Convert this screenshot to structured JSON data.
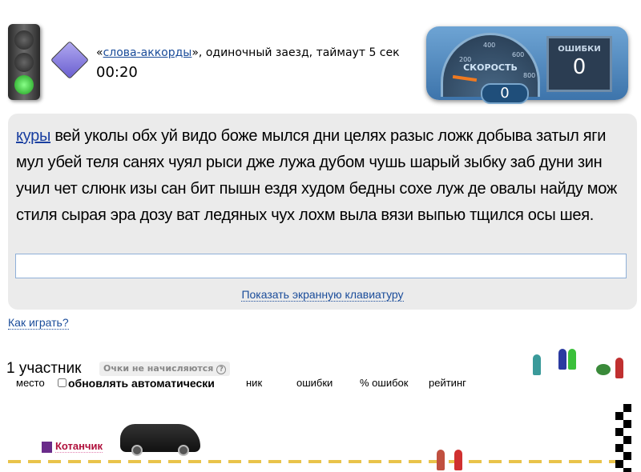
{
  "game": {
    "quote_open": "«",
    "mode_link": "слова-аккорды",
    "quote_rest": "», одиночный заезд, таймаут 5 сек",
    "timer": "00:20"
  },
  "dashboard": {
    "speed_label": "СКОРОСТЬ",
    "speed": "0",
    "ticks": [
      "200",
      "400",
      "600",
      "800"
    ],
    "errors_label": "ОШИБКИ",
    "errors": "0"
  },
  "text": {
    "current_word": "куры",
    "rest": " вей уколы обх уй видо боже мылся дни целях разыс ложк добыва затыл яги мул убей теля санях чуял рыси дже лужа дубом чушь шарый зыбку заб дуни зин учил чет слюнк изы сан бит пышн ездя худом бедны сохе луж де овалы найду мож стиля сырая эра дозу ват ледяных чух лохм выла вязи выпью тщился осы шея."
  },
  "input": {
    "value": ""
  },
  "keyboard_link": "Показать экранную клавиатуру",
  "how_to_play": "Как играть?",
  "participants": {
    "count": "1 участник",
    "no_points": "Очки не начисляются",
    "help": "?"
  },
  "table_headers": {
    "place": "место",
    "auto_update": "обновлять автоматически",
    "nick": "ник",
    "errors": "ошибки",
    "errors_pct": "% ошибок",
    "rating": "рейтинг"
  },
  "player": {
    "name": "Котанчик"
  }
}
